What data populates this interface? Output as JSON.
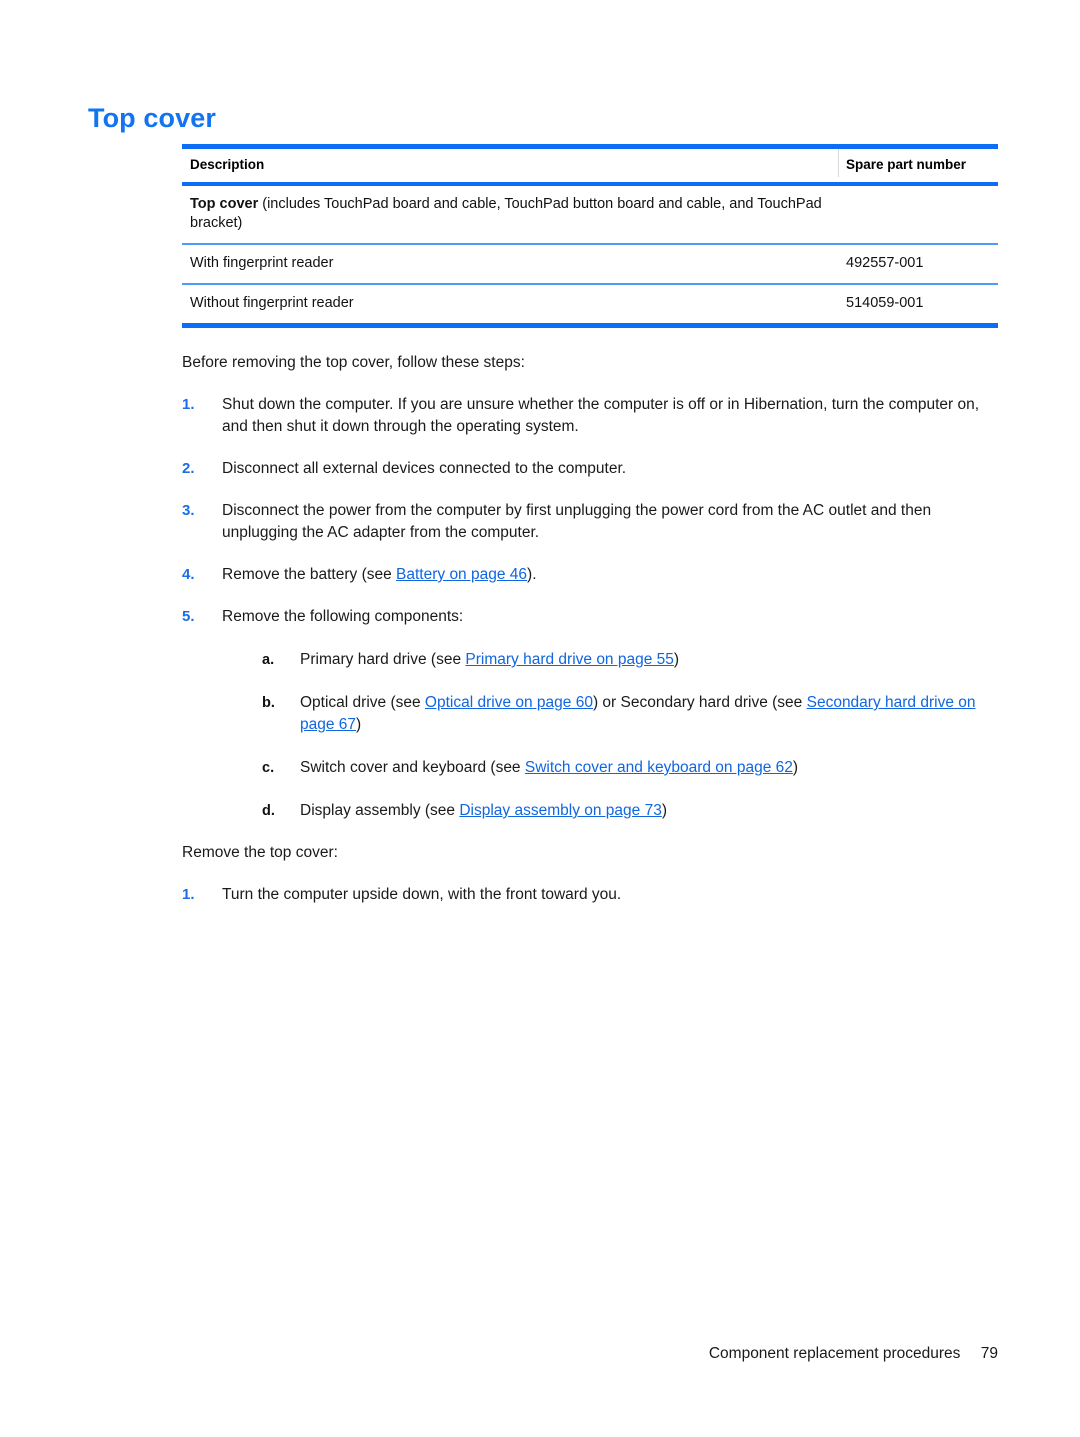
{
  "document": {
    "heading": "Top cover"
  },
  "parts_table": {
    "headers": {
      "description": "Description",
      "spare_part_number": "Spare part number"
    },
    "rows": [
      {
        "description_bold": "Top cover",
        "description_rest": " (includes TouchPad board and cable, TouchPad button board and cable, and TouchPad bracket)",
        "spare_part_number": ""
      },
      {
        "description_bold": "",
        "description_rest": "With fingerprint reader",
        "spare_part_number": "492557-001"
      },
      {
        "description_bold": "",
        "description_rest": "Without fingerprint reader",
        "spare_part_number": "514059-001"
      }
    ]
  },
  "body": {
    "intro": "Before removing the top cover, follow these steps:",
    "steps": [
      {
        "number": "1.",
        "text": "Shut down the computer. If you are unsure whether the computer is off or in Hibernation, turn the computer on, and then shut it down through the operating system."
      },
      {
        "number": "2.",
        "text": "Disconnect all external devices connected to the computer."
      },
      {
        "number": "3.",
        "text": "Disconnect the power from the computer by first unplugging the power cord from the AC outlet and then unplugging the AC adapter from the computer."
      },
      {
        "number": "4.",
        "text_before": "Remove the battery (see ",
        "link": "Battery on page 46",
        "text_after": ")."
      },
      {
        "number": "5.",
        "text": "Remove the following components:"
      }
    ],
    "substeps": [
      {
        "letter": "a.",
        "text_before": "Primary hard drive (see ",
        "link": "Primary hard drive on page 55",
        "text_after": ")"
      },
      {
        "letter": "b.",
        "text_before": "Optical drive (see ",
        "link": "Optical drive on page 60",
        "text_middle": ") or Secondary hard drive (see ",
        "link2": "Secondary hard drive on page 67",
        "text_after": ")"
      },
      {
        "letter": "c.",
        "text_before": "Switch cover and keyboard (see ",
        "link": "Switch cover and keyboard on page 62",
        "text_after": ")"
      },
      {
        "letter": "d.",
        "text_before": "Display assembly (see ",
        "link": "Display assembly on page 73",
        "text_after": ")"
      }
    ],
    "remove_lead": "Remove the top cover:",
    "remove_steps": [
      {
        "number": "1.",
        "text": "Turn the computer upside down, with the front toward you."
      }
    ]
  },
  "footer": {
    "section": "Component replacement procedures",
    "page_number": "79"
  },
  "colors": {
    "heading_blue": "#1374f0",
    "rule_blue": "#0b6ef5",
    "thin_rule_blue": "#4d9bf7",
    "link_blue": "#1166e0",
    "marker_blue": "#1a6fe8"
  }
}
